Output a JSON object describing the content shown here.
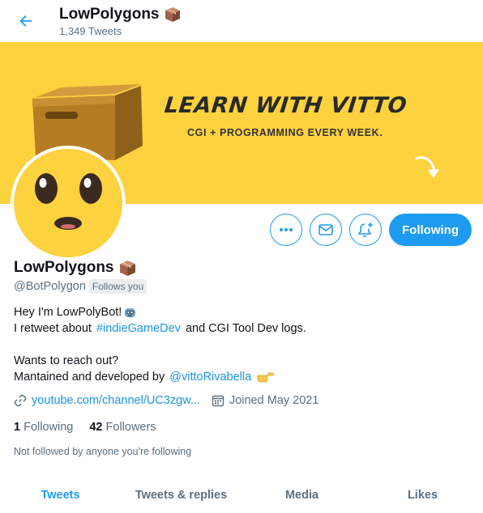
{
  "header": {
    "title": "LowPolygons",
    "tweet_count": "1,349 Tweets"
  },
  "banner": {
    "headline": "LEARN WITH VITTO",
    "tagline": "CGI + PROGRAMMING EVERY WEEK.",
    "color": "#fdd23f"
  },
  "actions": {
    "follow_label": "Following"
  },
  "profile": {
    "name": "LowPolygons",
    "handle": "@BotPolygon",
    "follows_you": "Follows you",
    "bio": {
      "line1": "Hey I'm LowPolyBot!",
      "line2_pre": "I retweet about ",
      "line2_tag": "#indieGameDev",
      "line2_post": " and CGI Tool Dev logs.",
      "line3": "Wants to reach out?",
      "line4_pre": "Mantained and developed by ",
      "line4_mention": "@vittoRivabella"
    },
    "website": "youtube.com/channel/UC3zgw...",
    "joined": "Joined May 2021",
    "following_count": "1",
    "following_label": "Following",
    "followers_count": "42",
    "followers_label": "Followers",
    "not_followed": "Not followed by anyone you're following"
  },
  "tabs": [
    {
      "label": "Tweets",
      "active": true
    },
    {
      "label": "Tweets & replies",
      "active": false
    },
    {
      "label": "Media",
      "active": false
    },
    {
      "label": "Likes",
      "active": false
    }
  ],
  "colors": {
    "accent": "#1d9bf0",
    "link": "#1b95e0",
    "secondary_text": "#5b7083"
  }
}
